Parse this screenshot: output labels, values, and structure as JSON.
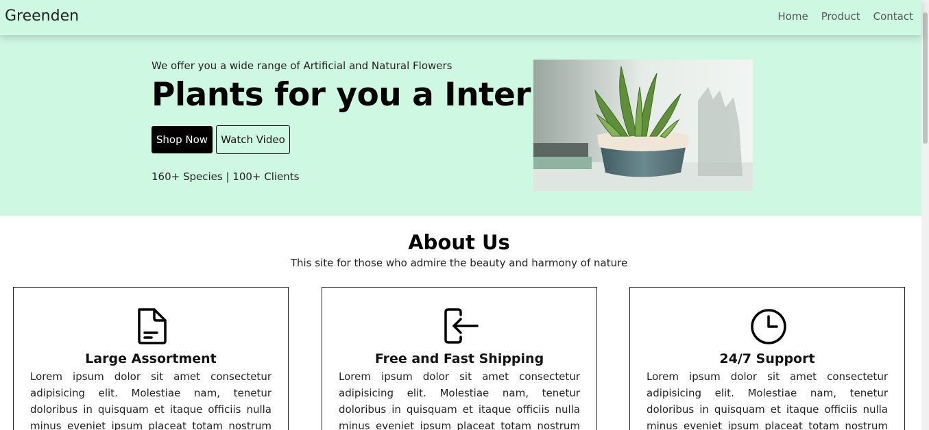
{
  "nav": {
    "brand": "Greenden",
    "links": [
      "Home",
      "Product",
      "Contact"
    ]
  },
  "hero": {
    "subtitle": "We offer you a wide range of Artificial and Natural Flowers",
    "title": "Plants for you a Interior",
    "primary_button": "Shop Now",
    "secondary_button": "Watch Video",
    "stats": "160+ Species | 100+ Clients"
  },
  "about": {
    "title": "About Us",
    "subtitle": "This site for those who admire the beauty and harmony of nature",
    "cards": [
      {
        "icon": "document-icon",
        "title": "Large Assortment",
        "text": "Lorem ipsum dolor sit amet consectetur adipisicing elit. Molestiae nam, tenetur doloribus in quisquam et itaque officiis nulla minus eveniet ipsum placeat totam nostrum ullam! Aut harum"
      },
      {
        "icon": "login-icon",
        "title": "Free and Fast Shipping",
        "text": "Lorem ipsum dolor sit amet consectetur adipisicing elit. Molestiae nam, tenetur doloribus in quisquam et itaque officiis nulla minus eveniet ipsum placeat totam nostrum ullam! Aut harum"
      },
      {
        "icon": "clock-icon",
        "title": "24/7 Support",
        "text": "Lorem ipsum dolor sit amet consectetur adipisicing elit. Molestiae nam, tenetur doloribus in quisquam et itaque officiis nulla minus eveniet ipsum placeat totam nostrum ullam! Aut harum"
      }
    ]
  },
  "colors": {
    "mint": "#cff8e3",
    "button_dark": "#000000"
  }
}
